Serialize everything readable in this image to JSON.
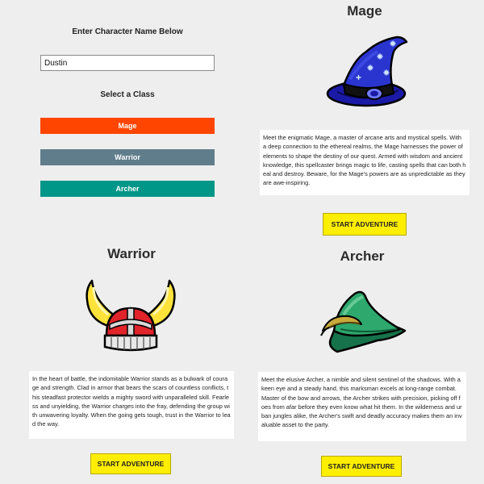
{
  "form": {
    "name_label": "Enter Character Name Below",
    "name_value": "Dustin",
    "class_label": "Select a Class",
    "buttons": [
      {
        "label": "Mage",
        "color": "#ff4500"
      },
      {
        "label": "Warrior",
        "color": "#607d8b"
      },
      {
        "label": "Archer",
        "color": "#009688"
      }
    ]
  },
  "classes": {
    "mage": {
      "title": "Mage",
      "icon": "wizard-hat",
      "description": "Meet the enigmatic Mage, a master of arcane arts and mystical spells. With a deep connection to the ethereal realms, the Mage harnesses the power of elements to shape the destiny of our quest. Armed with wisdom and ancient knowledge, this spellcaster brings magic to life, casting spells that can both heal and destroy. Beware, for the Mage's powers are as unpredictable as they are awe-inspiring.",
      "button": "START ADVENTURE"
    },
    "warrior": {
      "title": "Warrior",
      "icon": "viking-helmet",
      "description": "In the heart of battle, the indomitable Warrior stands as a bulwark of courage and strength. Clad in armor that bears the scars of countless conflicts, this steadfast protector wields a mighty sword with unparalleled skill. Fearless and unyielding, the Warrior charges into the fray, defending the group with unwavering loyalty. When the going gets tough, trust in the Warrior to lead the way.",
      "button": "START ADVENTURE"
    },
    "archer": {
      "title": "Archer",
      "icon": "archer-feathered-hat",
      "description": "Meet the elusive Archer, a nimble and silent sentinel of the shadows. With a keen eye and a steady hand, this marksman excels at long-range combat. Master of the bow and arrows, the Archer strikes with precision, picking off foes from afar before they even know what hit them. In the wilderness and urban jungles alike, the Archer's swift and deadly accuracy makes them an invaluable asset to the party.",
      "button": "START ADVENTURE"
    }
  },
  "colors": {
    "background": "#eeeeee",
    "adventure_button": "#ffee00"
  }
}
